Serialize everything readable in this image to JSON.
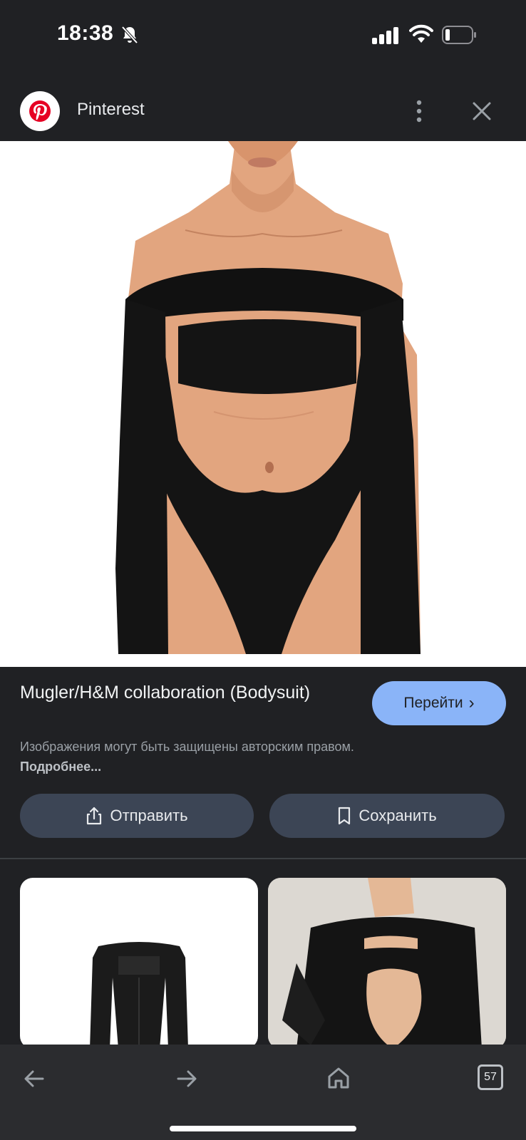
{
  "status": {
    "time": "18:38"
  },
  "header": {
    "site_name": "Pinterest"
  },
  "result": {
    "title": "Mugler/H&M collaboration (Bodysuit)",
    "visit_label": "Перейти",
    "notice_text": "Изображения могут быть защищены авторским правом.",
    "notice_link": "Подробнее..."
  },
  "actions": {
    "share_label": "Отправить",
    "save_label": "Сохранить"
  },
  "bottom_nav": {
    "tab_count": "57"
  },
  "colors": {
    "accent": "#8ab4f8",
    "pinterest_red": "#e60023",
    "background": "#202124"
  },
  "icons": [
    "bell-mute-icon",
    "signal-icon",
    "wifi-icon",
    "battery-icon",
    "pinterest-logo-icon",
    "more-vert-icon",
    "close-icon",
    "share-icon",
    "bookmark-icon",
    "back-arrow-icon",
    "forward-arrow-icon",
    "home-icon",
    "tabs-icon"
  ]
}
